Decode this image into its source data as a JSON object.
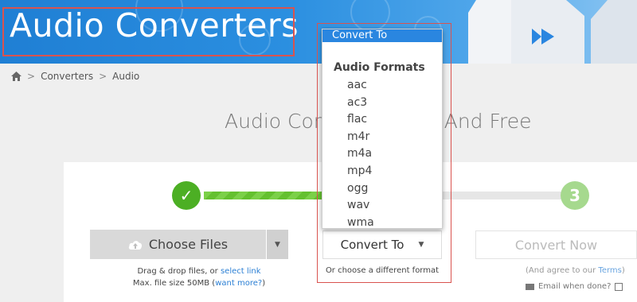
{
  "banner": {
    "title": "Audio Converters",
    "accent_color": "#2b8fe0",
    "highlight_color": "#d9534f"
  },
  "breadcrumb": {
    "home_icon": "home-icon",
    "items": [
      "Converters",
      "Audio"
    ],
    "separator": ">"
  },
  "heading": {
    "text": "Audio Conv",
    "text_tail": "e And Free"
  },
  "progress": {
    "step1_icon": "✓",
    "step3_label": "3",
    "done_color": "#4caf24",
    "todo_color": "#a6d98e"
  },
  "choose_files": {
    "label": "Choose Files",
    "icon": "cloud-upload-icon",
    "caret": "▼",
    "drag_text": "Drag & drop files, or ",
    "select_link": "select link",
    "max_text": "Max. file size 50MB (",
    "want_more": "want more?",
    "max_close": ")"
  },
  "convert_to": {
    "label": "Convert To",
    "caret": "▼",
    "note": "Or choose a different format"
  },
  "convert_now": {
    "label": "Convert Now",
    "agree_prefix": "(And agree to our ",
    "terms": "Terms",
    "agree_suffix": ")",
    "email_label": "Email when done?"
  },
  "dropdown": {
    "header": "Convert To",
    "group": "Audio Formats",
    "formats": [
      "aac",
      "ac3",
      "flac",
      "m4r",
      "m4a",
      "mp4",
      "ogg",
      "wav",
      "wma"
    ]
  }
}
